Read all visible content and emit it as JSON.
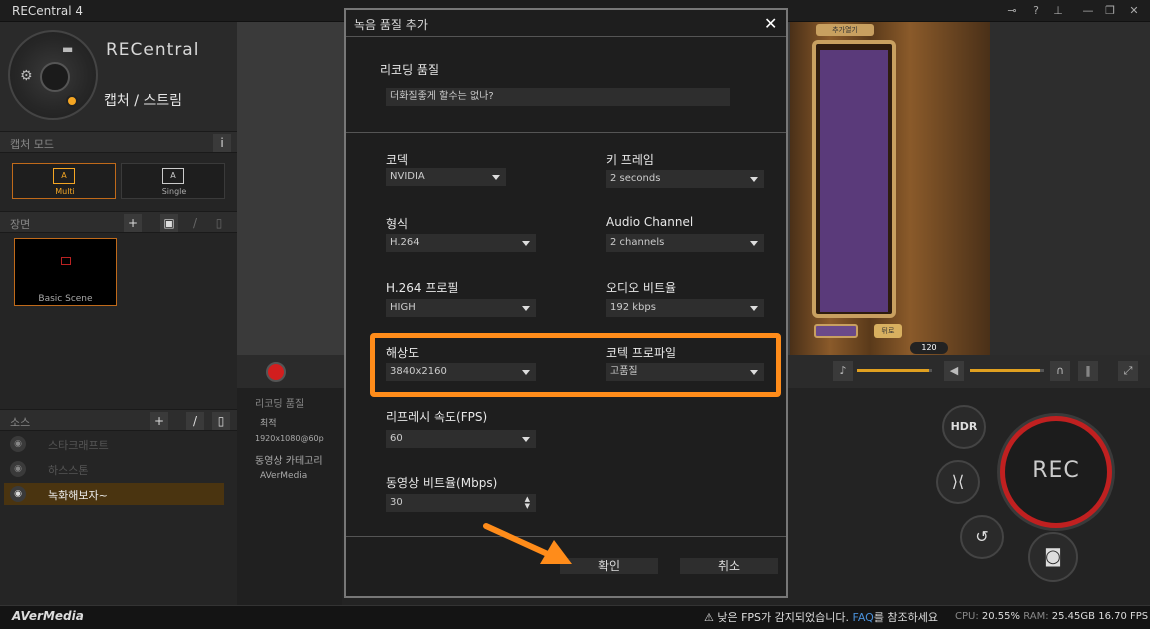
{
  "app": {
    "title": "RECentral 4",
    "brand": "RECentral",
    "subtitle": "캡처 / 스트림"
  },
  "window_controls": [
    "⊸",
    "?",
    "⊥",
    "—",
    "❐",
    "✕"
  ],
  "left": {
    "capture_mode_label": "캡처 모드",
    "info_label": "i",
    "modes": [
      {
        "label": "Multi",
        "icon": "A"
      },
      {
        "label": "Single",
        "icon": "A"
      }
    ],
    "scene_label": "장면",
    "scene_name": "Basic Scene",
    "source_label": "소스",
    "sources": [
      {
        "name": "스타크래프트"
      },
      {
        "name": "하스스톤"
      },
      {
        "name": "녹화해보자~"
      }
    ]
  },
  "center_info": {
    "rec_quality_label": "리코딩 품질",
    "quality": "최적",
    "resolution": "1920x1080@60p",
    "category_label": "동영상 카테고리",
    "category": "AVerMedia"
  },
  "game": {
    "tag": "추가열기",
    "button": "뒤로",
    "gold": "120"
  },
  "rec_controls": {
    "hdr": "HDR",
    "rec": "REC"
  },
  "status": {
    "logo": "AVerMedia",
    "warn_prefix": "⚠ 낮은 FPS가 감지되었습니다. ",
    "faq": "FAQ",
    "warn_suffix": "를 참조하세요",
    "cpu_label": "CPU: ",
    "cpu": "20.55%",
    "ram_label": " RAM: ",
    "ram": "25.45GB",
    "fps": " 16.70 FPS"
  },
  "dialog": {
    "title": "녹음 품질 추가",
    "close": "✕",
    "name_label": "리코딩 품질",
    "name_value": "더화질좋게 할수는 없나?",
    "codec_label": "코덱",
    "codec": "NVIDIA",
    "keyframe_label": "키 프레임",
    "keyframe": "2 seconds",
    "format_label": "형식",
    "format": "H.264",
    "audio_channel_label": "Audio Channel",
    "audio_channel": "2 channels",
    "profile_label": "H.264 프로필",
    "profile": "HIGH",
    "audio_bitrate_label": "오디오 비트율",
    "audio_bitrate": "192 kbps",
    "resolution_label": "해상도",
    "resolution": "3840x2160",
    "codec_profile_label": "코텍 프로파일",
    "codec_profile": "고품질",
    "fps_label": "리프레시 속도(FPS)",
    "fps": "60",
    "video_bitrate_label": "동영상 비트율(Mbps)",
    "video_bitrate": "30",
    "ok": "확인",
    "cancel": "취소"
  },
  "colors": {
    "accent": "#ff8c1a",
    "rec": "#c02020"
  }
}
